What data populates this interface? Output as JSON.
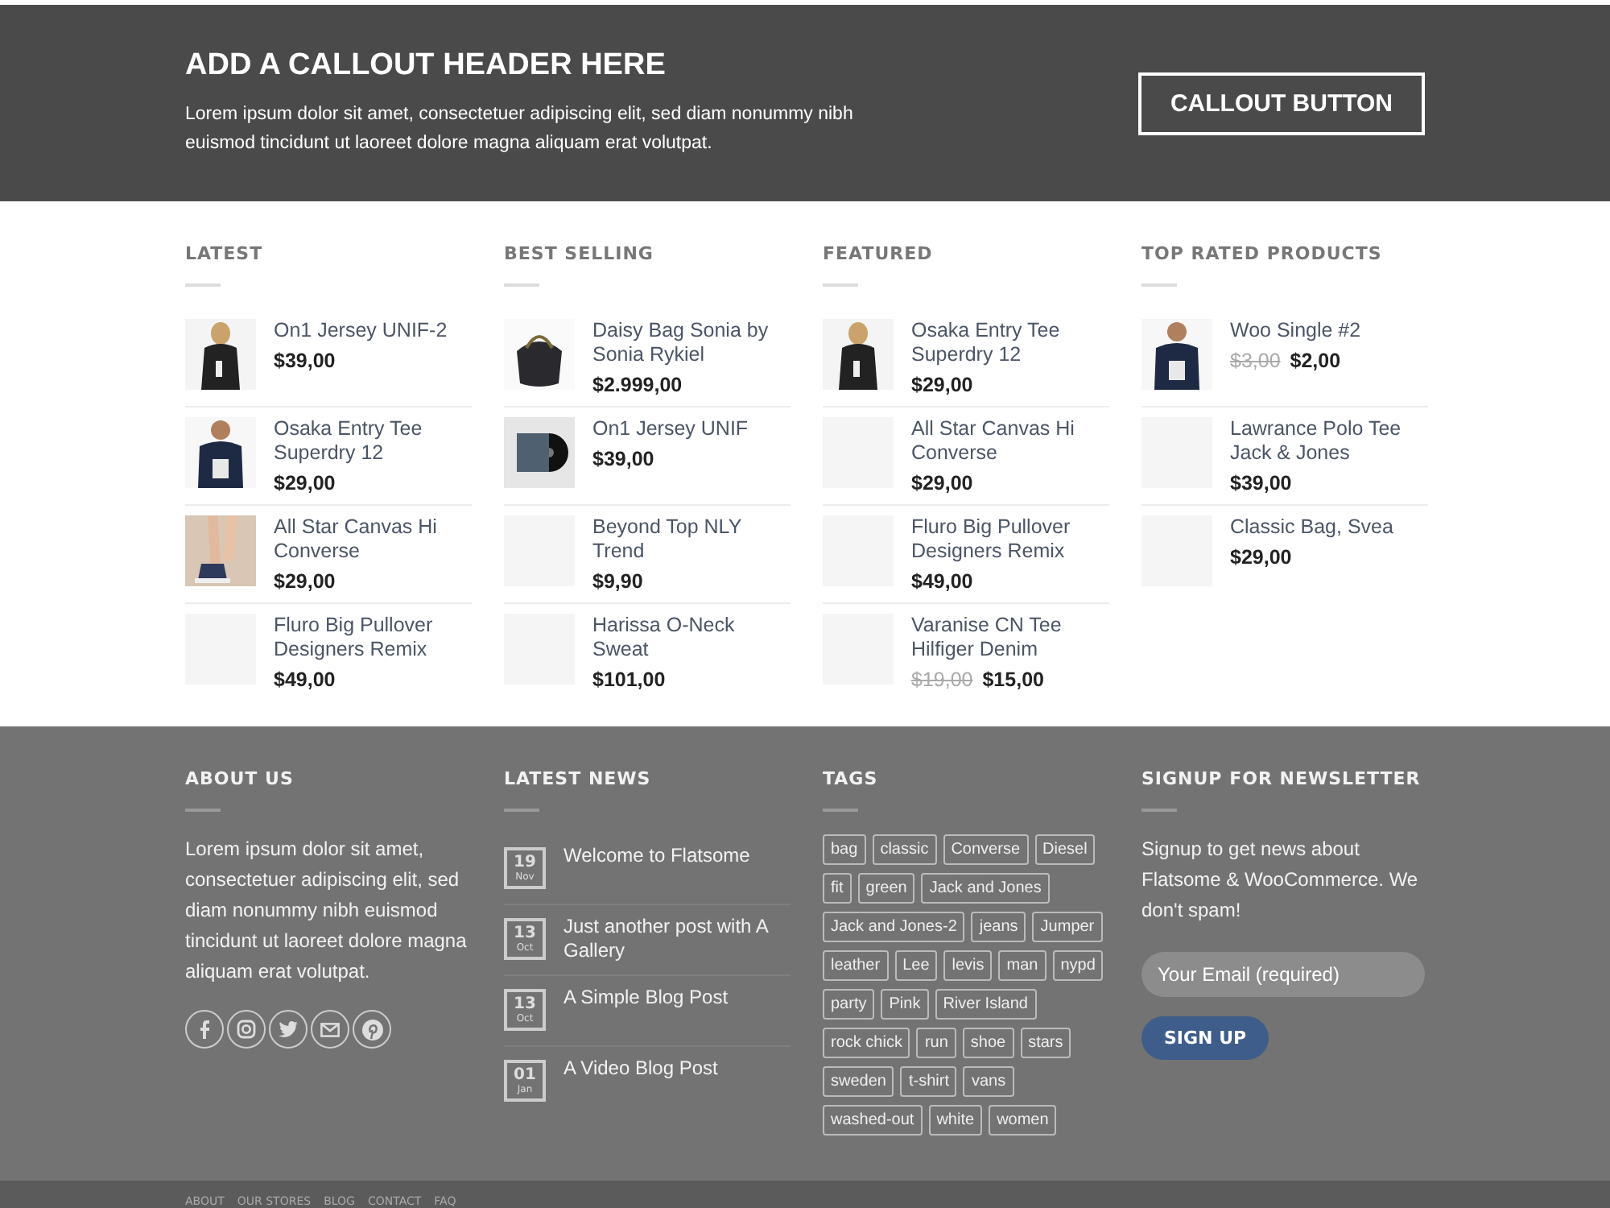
{
  "callout": {
    "title": "ADD A CALLOUT HEADER HERE",
    "text": "Lorem ipsum dolor sit amet, consectetuer adipiscing elit, sed diam nonummy nibh euismod tincidunt ut laoreet dolore magna aliquam erat volutpat.",
    "button": "CALLOUT BUTTON"
  },
  "product_columns": [
    {
      "title": "LATEST",
      "items": [
        {
          "name": "On1 Jersey UNIF-2",
          "price": "$39,00",
          "kind": "picture"
        },
        {
          "name": "Osaka Entry Tee Superdry 12",
          "price": "$29,00",
          "kind": "picture"
        },
        {
          "name": "All Star Canvas Hi Converse",
          "price": "$29,00",
          "kind": "picture"
        },
        {
          "name": "Fluro Big Pullover Designers Remix",
          "price": "$49,00",
          "kind": "placeholder"
        }
      ]
    },
    {
      "title": "BEST SELLING",
      "items": [
        {
          "name": "Daisy Bag Sonia by Sonia Rykiel",
          "price": "$2.999,00",
          "kind": "picture"
        },
        {
          "name": "On1 Jersey UNIF",
          "price": "$39,00",
          "kind": "picture"
        },
        {
          "name": "Beyond Top NLY Trend",
          "price": "$9,90",
          "kind": "placeholder"
        },
        {
          "name": "Harissa O-Neck Sweat",
          "price": "$101,00",
          "kind": "placeholder"
        }
      ]
    },
    {
      "title": "FEATURED",
      "items": [
        {
          "name": "Osaka Entry Tee Superdry 12",
          "price": "$29,00",
          "kind": "picture"
        },
        {
          "name": "All Star Canvas Hi Converse",
          "price": "$29,00",
          "kind": "placeholder"
        },
        {
          "name": "Fluro Big Pullover Designers Remix",
          "price": "$49,00",
          "kind": "placeholder"
        },
        {
          "name": "Varanise CN Tee Hilfiger Denim",
          "old_price": "$19,00",
          "price": "$15,00",
          "kind": "placeholder"
        }
      ]
    },
    {
      "title": "TOP RATED PRODUCTS",
      "items": [
        {
          "name": "Woo Single #2",
          "old_price": "$3,00",
          "price": "$2,00",
          "kind": "picture"
        },
        {
          "name": "Lawrance Polo Tee Jack & Jones",
          "price": "$39,00",
          "kind": "placeholder"
        },
        {
          "name": "Classic Bag, Svea",
          "price": "$29,00",
          "kind": "placeholder"
        }
      ]
    }
  ],
  "footer": {
    "about": {
      "title": "ABOUT US",
      "text": "Lorem ipsum dolor sit amet, consectetuer adipiscing elit, sed diam nonummy nibh euismod tincidunt ut laoreet dolore magna aliquam erat volutpat.",
      "social": [
        {
          "kind": "facebook"
        },
        {
          "kind": "instagram"
        },
        {
          "kind": "twitter"
        },
        {
          "kind": "email"
        },
        {
          "kind": "pinterest"
        }
      ]
    },
    "news": {
      "title": "LATEST NEWS",
      "posts": [
        {
          "day": "19",
          "month": "Nov",
          "title": "Welcome to Flatsome"
        },
        {
          "day": "13",
          "month": "Oct",
          "title": "Just another post with A Gallery"
        },
        {
          "day": "13",
          "month": "Oct",
          "title": "A Simple Blog Post"
        },
        {
          "day": "01",
          "month": "Jan",
          "title": "A Video Blog Post"
        }
      ]
    },
    "tags": {
      "title": "TAGS",
      "items": [
        "bag",
        "classic",
        "Converse",
        "Diesel",
        "fit",
        "green",
        "Jack and Jones",
        "Jack and Jones-2",
        "jeans",
        "Jumper",
        "leather",
        "Lee",
        "levis",
        "man",
        "nypd",
        "party",
        "Pink",
        "River Island",
        "rock chick",
        "run",
        "shoe",
        "stars",
        "sweden",
        "t-shirt",
        "vans",
        "washed-out",
        "white",
        "women"
      ]
    },
    "newsletter": {
      "title": "SIGNUP FOR NEWSLETTER",
      "text": "Signup to get news about Flatsome & WooCommerce. We don't spam!",
      "placeholder": "Your Email (required)",
      "button": "SIGN UP"
    }
  },
  "bottom_links": [
    "ABOUT",
    "OUR STORES",
    "BLOG",
    "CONTACT",
    "FAQ"
  ]
}
